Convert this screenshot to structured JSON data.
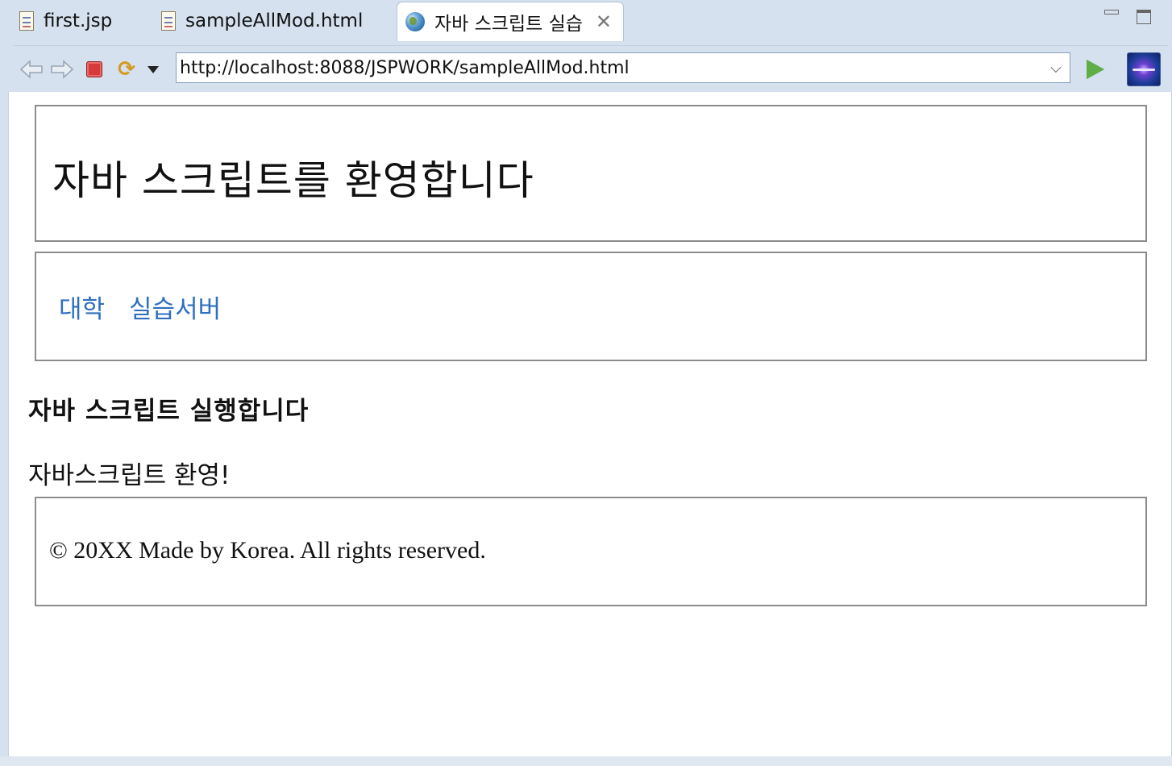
{
  "tabs": [
    {
      "label": "first.jsp",
      "icon": "jsp-file-icon",
      "active": false
    },
    {
      "label": "sampleAllMod.html",
      "icon": "html-file-icon",
      "active": false
    },
    {
      "label": "자바 스크립트 실습",
      "icon": "globe-icon",
      "active": true
    }
  ],
  "toolbar": {
    "url": "http://localhost:8088/JSPWORK/sampleAllMod.html"
  },
  "page": {
    "header_title": "자바 스크립트를 환영합니다",
    "nav_links": [
      "대학",
      "실습서버"
    ],
    "run_heading": "자바 스크립트 실행합니다",
    "welcome_text": "자바스크립트 환영!",
    "footer_text": "© 20XX Made by Korea. All rights reserved."
  },
  "colors": {
    "link": "#2f6fbf",
    "chrome_bg": "#d5e1ee",
    "box_border": "#8c8c8c"
  }
}
